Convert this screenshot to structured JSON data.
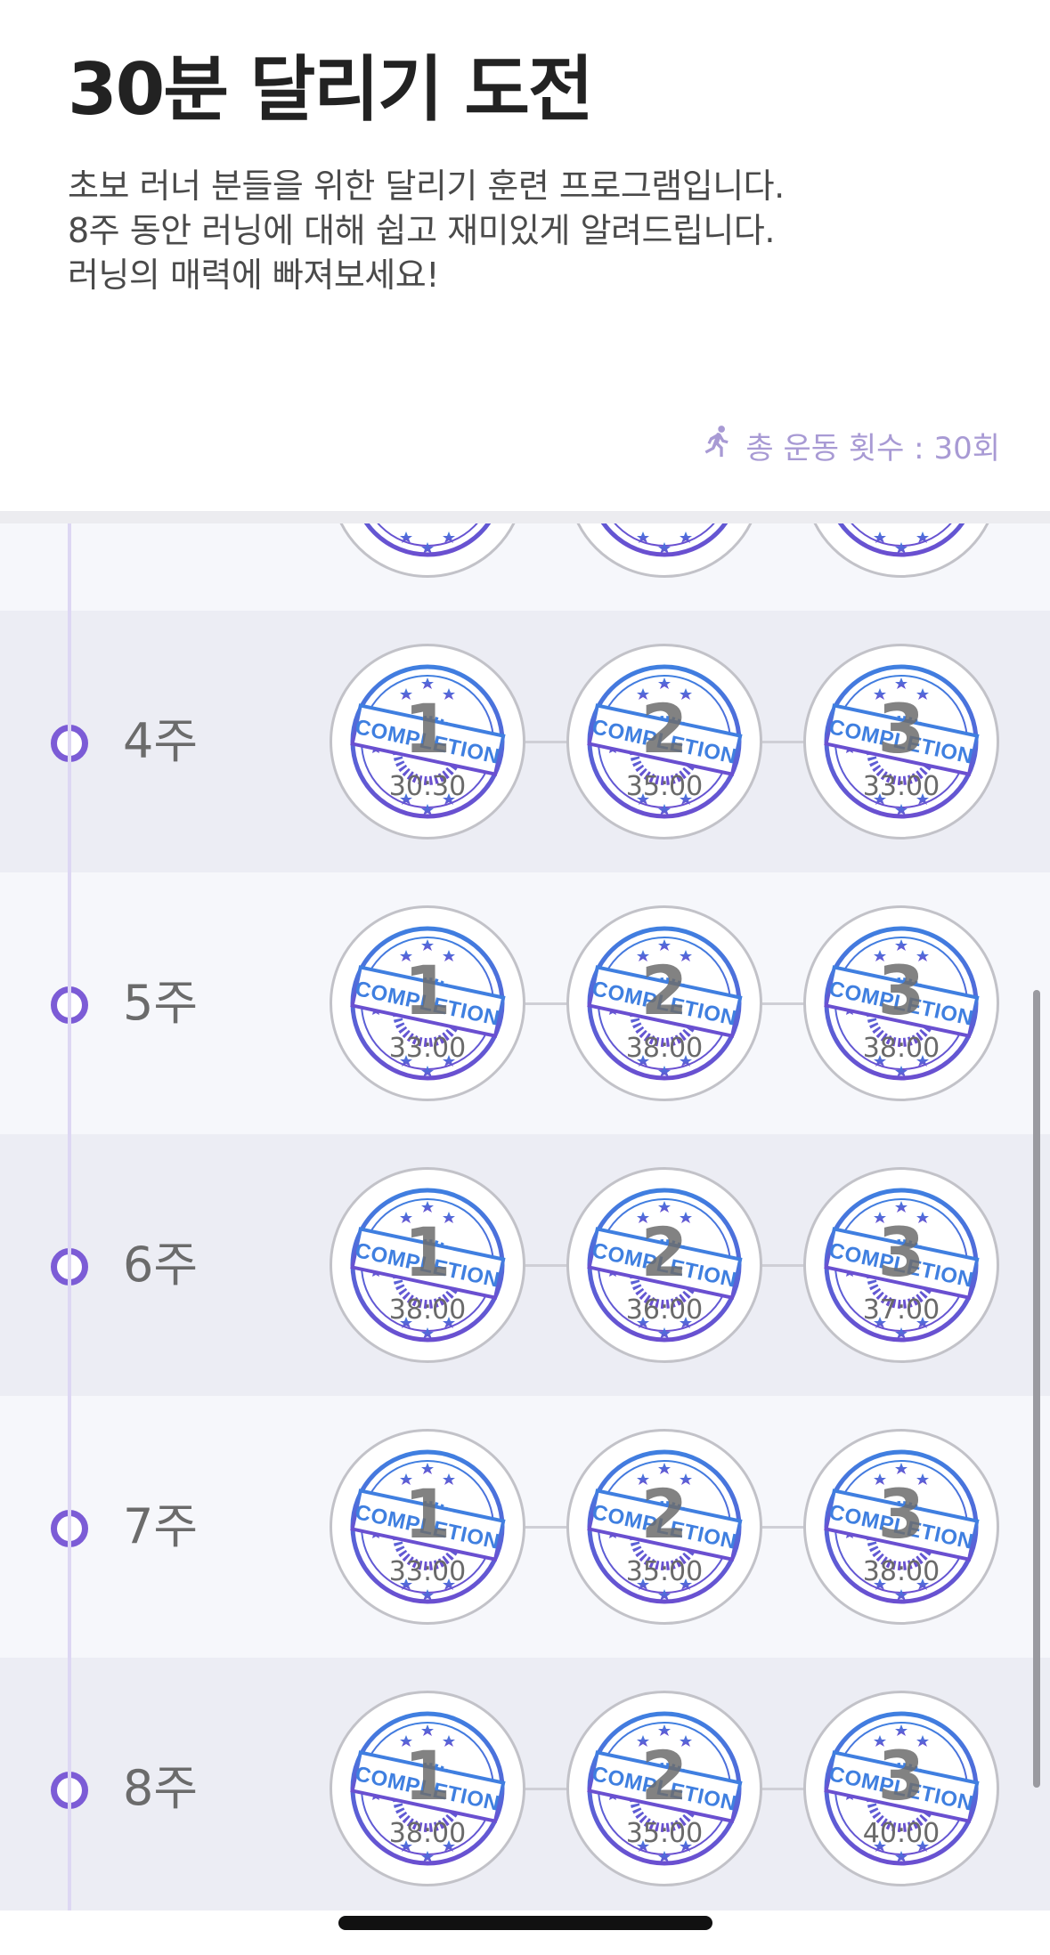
{
  "header": {
    "title": "30분 달리기 도전",
    "description": [
      "초보 러너 분들을 위한 달리기 훈련 프로그램입니다.",
      "8주 동안 러닝에 대해 쉽고 재미있게 알려드립니다.",
      "러닝의 매력에 빠져보세요!"
    ],
    "total_label": "총 운동 횟수 : 30회",
    "total_icon": "running-icon"
  },
  "stamp_text": "COMPLETION",
  "colors": {
    "accent": "#7c5cd6",
    "stamp_blue": "#3f7fe0",
    "stamp_purple": "#6a4fd0",
    "total_text": "#a89ad4"
  },
  "weeks": [
    {
      "label": "",
      "sessions": [
        {
          "num": "",
          "time": ""
        },
        {
          "num": "",
          "time": ""
        },
        {
          "num": "",
          "time": ""
        }
      ]
    },
    {
      "label": "4주",
      "sessions": [
        {
          "num": "1",
          "time": "30:30"
        },
        {
          "num": "2",
          "time": "35:00"
        },
        {
          "num": "3",
          "time": "33:00"
        }
      ]
    },
    {
      "label": "5주",
      "sessions": [
        {
          "num": "1",
          "time": "33:00"
        },
        {
          "num": "2",
          "time": "38:00"
        },
        {
          "num": "3",
          "time": "38:00"
        }
      ]
    },
    {
      "label": "6주",
      "sessions": [
        {
          "num": "1",
          "time": "38:00"
        },
        {
          "num": "2",
          "time": "36:00"
        },
        {
          "num": "3",
          "time": "37:00"
        }
      ]
    },
    {
      "label": "7주",
      "sessions": [
        {
          "num": "1",
          "time": "33:00"
        },
        {
          "num": "2",
          "time": "35:00"
        },
        {
          "num": "3",
          "time": "38:00"
        }
      ]
    },
    {
      "label": "8주",
      "sessions": [
        {
          "num": "1",
          "time": "38:00"
        },
        {
          "num": "2",
          "time": "35:00"
        },
        {
          "num": "3",
          "time": "40:00"
        }
      ]
    }
  ]
}
